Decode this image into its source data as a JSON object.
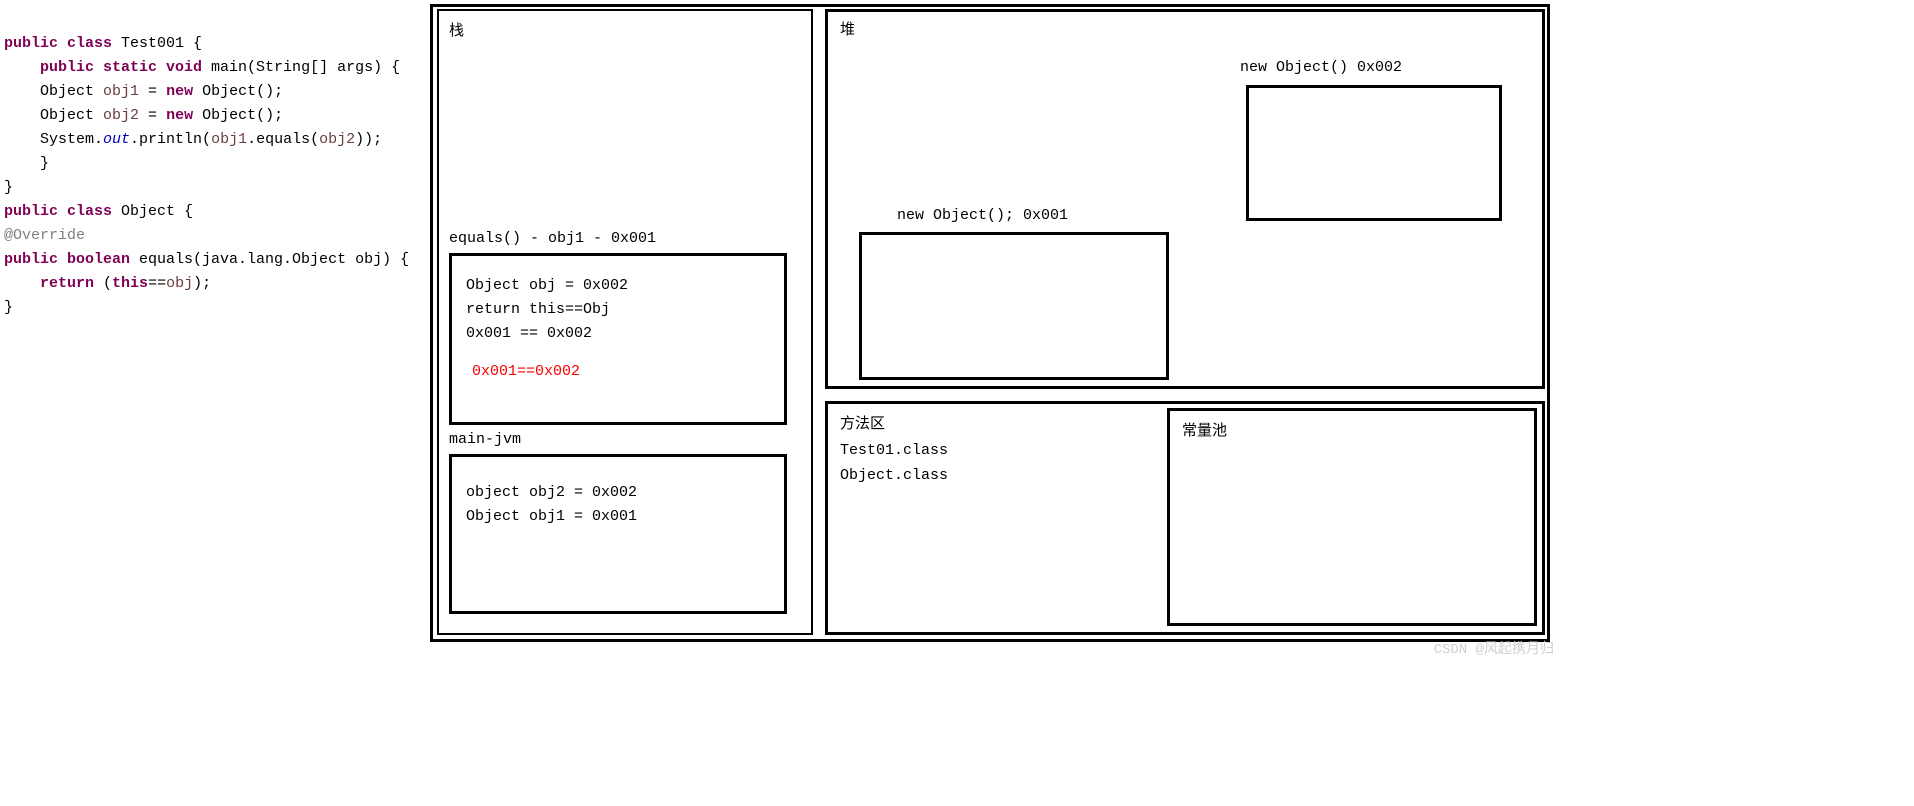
{
  "code": {
    "line1_kw1": "public class",
    "line1_cls": " Test001 {",
    "line2_indent": "    ",
    "line2_kw": "public static void",
    "line2_rest": " main(String[] args) {",
    "line3": "    Object ",
    "line3_var": "obj1",
    "line3_mid": " = ",
    "line3_kw": "new",
    "line3_end": " Object();",
    "line4": "    Object ",
    "line4_var": "obj2",
    "line4_mid": " = ",
    "line4_kw": "new",
    "line4_end": " Object();",
    "line5a": "    System.",
    "line5field": "out",
    "line5b": ".println(",
    "line5var1": "obj1",
    "line5mid": ".equals(",
    "line5var2": "obj2",
    "line5end": "));",
    "line6": "    }",
    "line7": "}",
    "obj_line1_kw": "public class",
    "obj_line1_rest": " Object {",
    "obj_ann": "@Override",
    "obj_line2_kw": "public boolean",
    "obj_line2_rest": " equals(java.lang.Object obj) {",
    "obj_line3_indent": "    ",
    "obj_line3_kw": "return",
    "obj_line3_paren": " (",
    "obj_line3_this": "this",
    "obj_line3_eq": "==",
    "obj_line3_var": "obj",
    "obj_line3_end": ");",
    "obj_line4": "}"
  },
  "stack": {
    "title": "栈",
    "equals_label": "equals() - obj1 - 0x001",
    "equals_frame": {
      "l1": "Object obj = 0x002",
      "l2": "return this==Obj",
      "l3": "0x001 == 0x002",
      "red": "0x001==0x002"
    },
    "main_label": "main-jvm",
    "main_frame": {
      "l1": "object obj2 = 0x002",
      "l2": "Object obj1 = 0x001"
    }
  },
  "heap": {
    "title": "堆",
    "obj2_label": "new Object()  0x002",
    "obj1_label": "new Object();    0x001"
  },
  "method_area": {
    "title": "方法区",
    "l1": "Test01.class",
    "l2": "Object.class"
  },
  "const_pool": {
    "title": "常量池"
  },
  "watermark": "CSDN @风起携月归"
}
